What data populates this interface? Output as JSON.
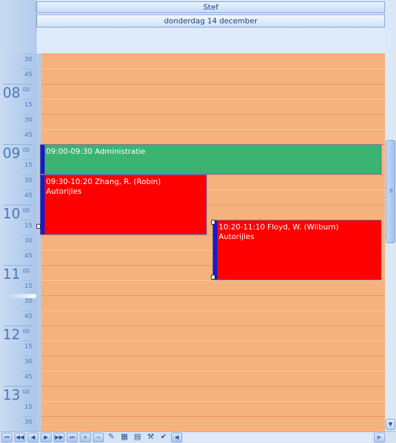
{
  "header": {
    "resource": "Stef",
    "date": "donderdag 14 december"
  },
  "ruler": {
    "hours": [
      {
        "hour": "08",
        "minutes": "00"
      },
      {
        "hour": "09",
        "minutes": "00"
      },
      {
        "hour": "10",
        "minutes": "00"
      },
      {
        "hour": "11",
        "minutes": "00"
      },
      {
        "hour": "12",
        "minutes": "00"
      },
      {
        "hour": "13",
        "minutes": "00"
      }
    ],
    "quarter_labels": [
      "15",
      "30",
      "45"
    ]
  },
  "appointments": [
    {
      "time": "09:00-09:30",
      "title": "Administratie",
      "subtitle": "",
      "color": "#3cb371"
    },
    {
      "time": "09:30-10:20",
      "title": "Zhang, R. (Robin)",
      "subtitle": "Autorijles",
      "color": "#ff0000"
    },
    {
      "time": "10:20-11:10",
      "title": "Floyd, W. (Wilburn)",
      "subtitle": "Autorijles",
      "color": "#ff0000"
    }
  ],
  "appointment_text": [
    "09:00-09:30 Administratie",
    "09:30-10:20 Zhang, R. (Robin)",
    "10:20-11:10 Floyd, W. (Wilburn)"
  ],
  "toolbar": {
    "buttons": [
      {
        "name": "first-page",
        "icon": "⏮"
      },
      {
        "name": "prev-fast",
        "icon": "◀◀"
      },
      {
        "name": "prev",
        "icon": "◀"
      },
      {
        "name": "next",
        "icon": "▶"
      },
      {
        "name": "next-fast",
        "icon": "▶▶"
      },
      {
        "name": "last-page",
        "icon": "⏭"
      },
      {
        "name": "add",
        "icon": "+"
      },
      {
        "name": "remove",
        "icon": "−"
      },
      {
        "name": "edit",
        "icon": "✎"
      },
      {
        "name": "save-all",
        "icon": "▦"
      },
      {
        "name": "save",
        "icon": "▤"
      },
      {
        "name": "tools",
        "icon": "⚒"
      },
      {
        "name": "calendar-check",
        "icon": "✔"
      },
      {
        "name": "scroll-left",
        "icon": "◀"
      }
    ],
    "scroll_right_icon": "▶"
  },
  "scrollbar": {
    "down_icon": "▼"
  },
  "colors": {
    "slot": "#f5b27d",
    "accent": "#15428b",
    "indicator": "#1a1ac8"
  }
}
